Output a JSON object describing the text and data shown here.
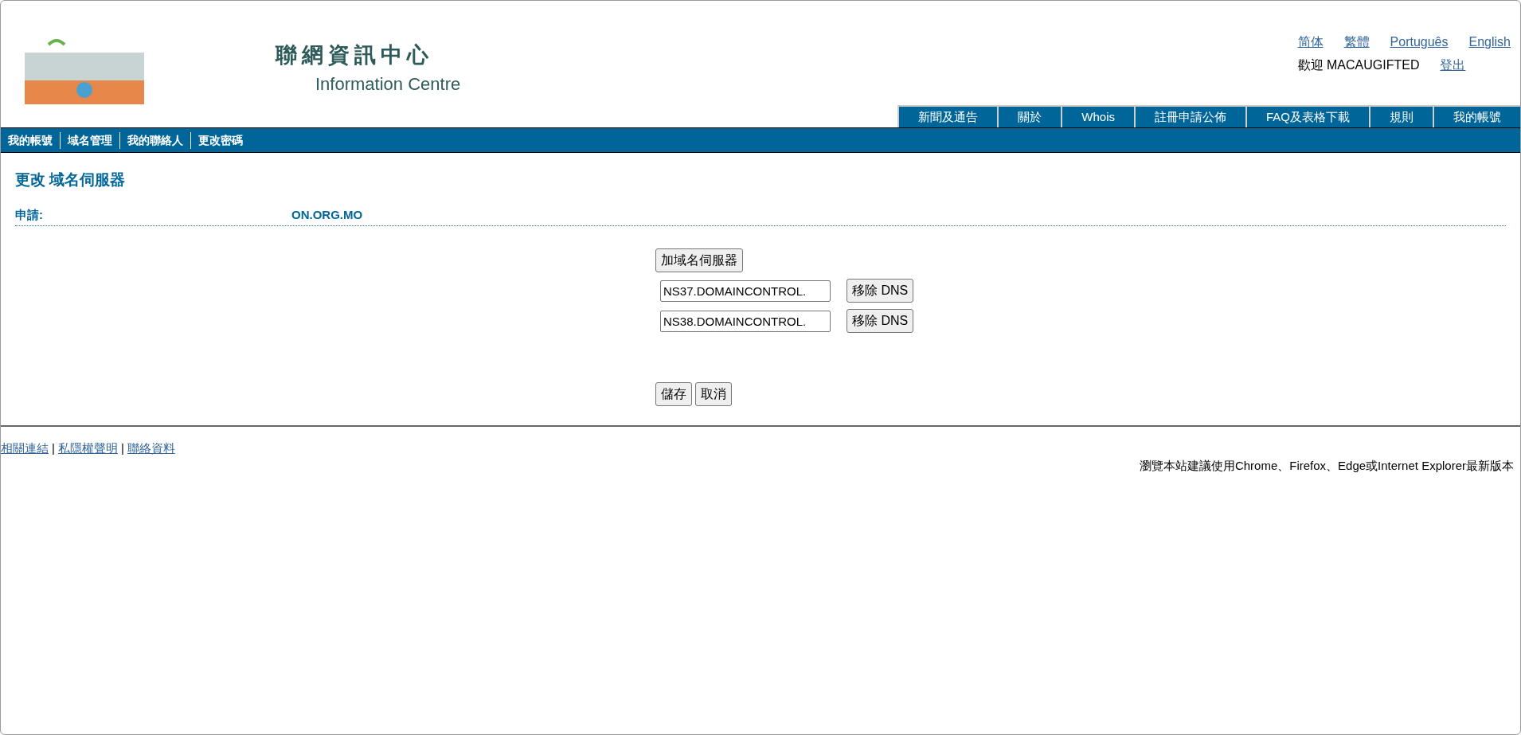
{
  "header": {
    "site_title_zh": "聯網資訊中心",
    "site_title_en": "Information Centre",
    "languages": [
      {
        "label": "简体"
      },
      {
        "label": "繁體"
      },
      {
        "label": "Português"
      },
      {
        "label": "English"
      }
    ],
    "welcome": "歡迎 MACAUGIFTED",
    "logout": "登出"
  },
  "top_tabs": [
    {
      "label": "新聞及通告"
    },
    {
      "label": "關於"
    },
    {
      "label": "Whois"
    },
    {
      "label": "註冊申請公佈"
    },
    {
      "label": "FAQ及表格下載"
    },
    {
      "label": "規則"
    },
    {
      "label": "我的帳號"
    }
  ],
  "sub_nav": [
    {
      "label": "我的帳號"
    },
    {
      "label": "域名管理"
    },
    {
      "label": "我的聯絡人"
    },
    {
      "label": "更改密碼"
    }
  ],
  "page_title": "更改 域名伺服器",
  "application": {
    "label": "申請:",
    "value": "ON.ORG.MO"
  },
  "add_button": "加域名伺服器",
  "nameservers": [
    {
      "value": "NS37.DOMAINCONTROL.",
      "remove": "移除 DNS"
    },
    {
      "value": "NS38.DOMAINCONTROL.",
      "remove": "移除 DNS"
    }
  ],
  "save": "儲存",
  "cancel": "取消",
  "footer": {
    "links": [
      {
        "label": "相關連結"
      },
      {
        "label": "私隱權聲明"
      },
      {
        "label": "聯絡資料"
      }
    ],
    "separators": [
      "|",
      "|"
    ],
    "browser_note": "瀏覽本站建議使用Chrome、Firefox、Edge或Internet Explorer最新版本"
  }
}
